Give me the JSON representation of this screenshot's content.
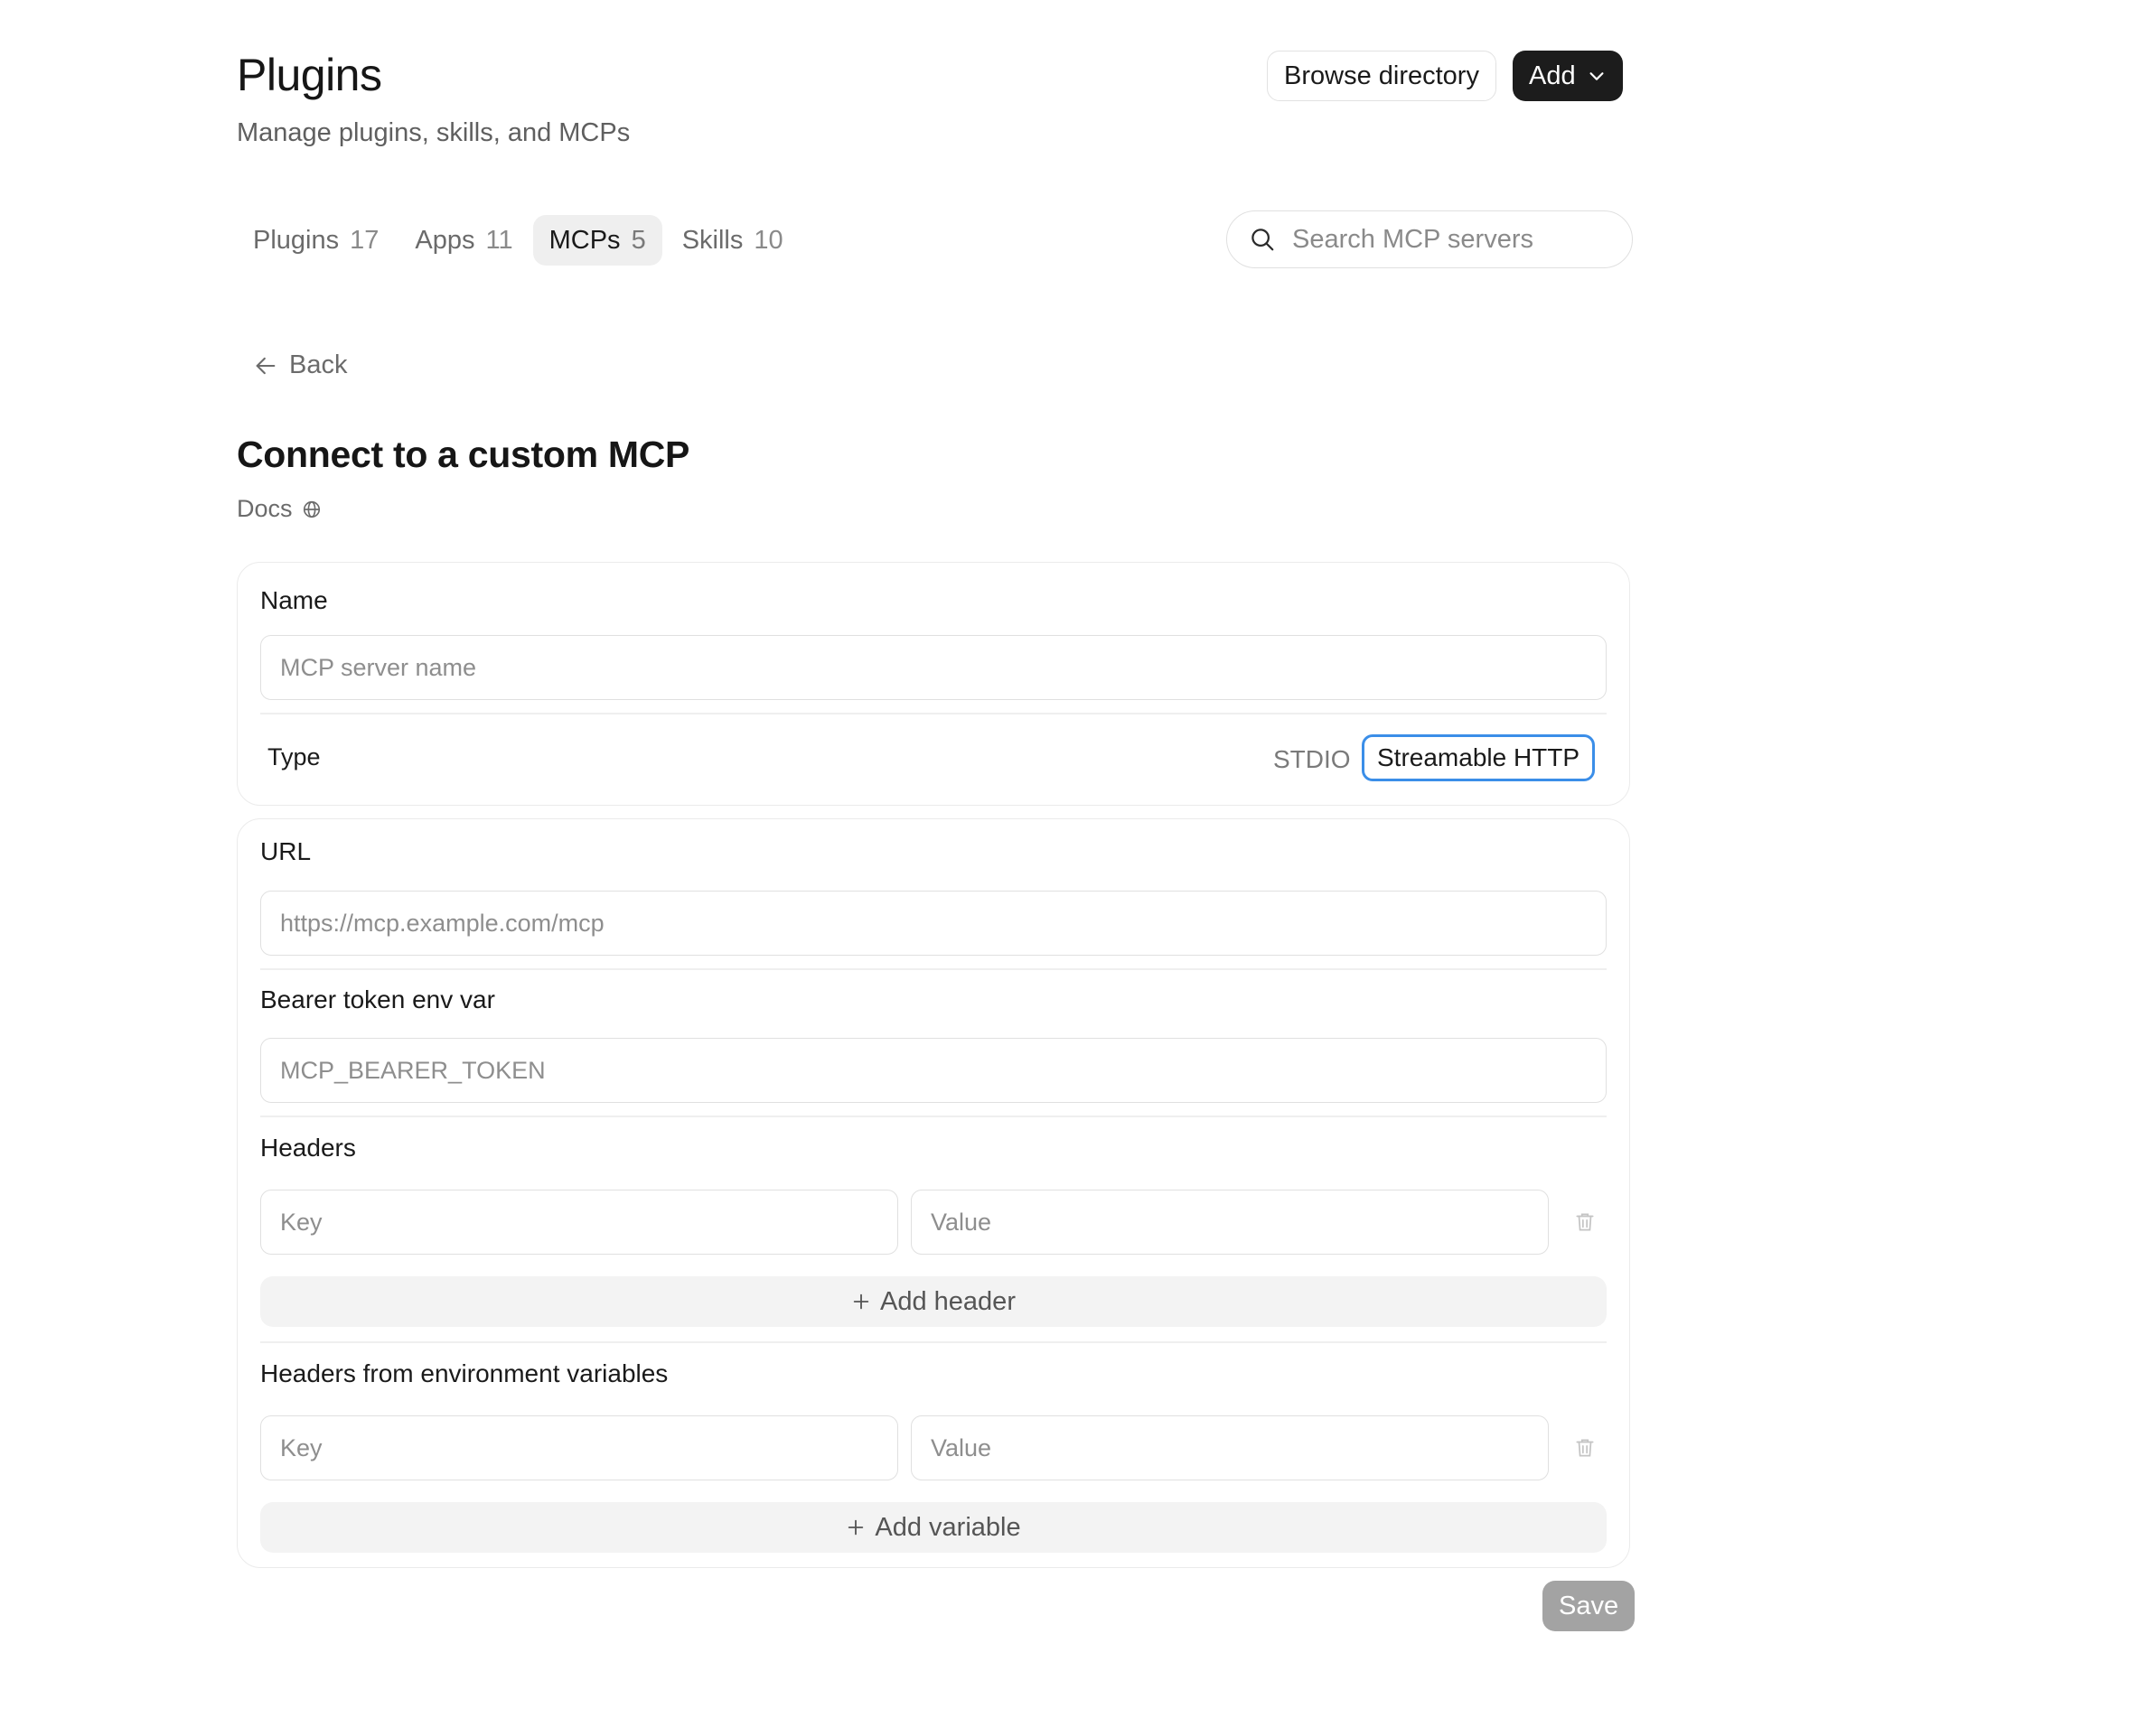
{
  "header": {
    "title": "Plugins",
    "subtitle": "Manage plugins, skills, and MCPs",
    "browse_label": "Browse directory",
    "add_label": "Add"
  },
  "tabs": [
    {
      "label": "Plugins",
      "count": "17",
      "active": false
    },
    {
      "label": "Apps",
      "count": "11",
      "active": false
    },
    {
      "label": "MCPs",
      "count": "5",
      "active": true
    },
    {
      "label": "Skills",
      "count": "10",
      "active": false
    }
  ],
  "search": {
    "placeholder": "Search MCP servers"
  },
  "back": {
    "label": "Back"
  },
  "form": {
    "title": "Connect to a custom MCP",
    "docs_label": "Docs",
    "name": {
      "label": "Name",
      "placeholder": "MCP server name",
      "value": ""
    },
    "type": {
      "label": "Type",
      "options": [
        "STDIO",
        "Streamable HTTP"
      ],
      "selected": "Streamable HTTP"
    },
    "url": {
      "label": "URL",
      "placeholder": "https://mcp.example.com/mcp",
      "value": ""
    },
    "bearer": {
      "label": "Bearer token env var",
      "placeholder": "MCP_BEARER_TOKEN",
      "value": ""
    },
    "headers": {
      "label": "Headers",
      "key_placeholder": "Key",
      "value_placeholder": "Value",
      "add_label": "Add header"
    },
    "env_headers": {
      "label": "Headers from environment variables",
      "key_placeholder": "Key",
      "value_placeholder": "Value",
      "add_label": "Add variable"
    },
    "save_label": "Save"
  },
  "colors": {
    "accent_focus": "#3b8ee8",
    "primary_button": "#1c1c1c",
    "disabled_button": "#a3a3a3"
  },
  "icons": [
    "chevron-down-icon",
    "search-icon",
    "arrow-left-icon",
    "globe-icon",
    "trash-icon",
    "plus-icon"
  ]
}
